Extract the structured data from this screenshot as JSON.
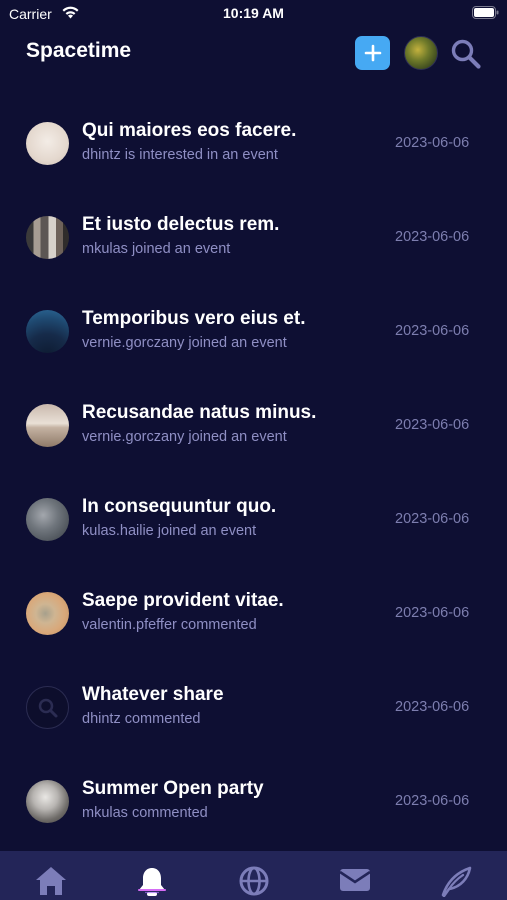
{
  "status_bar": {
    "carrier": "Carrier",
    "time": "10:19 AM"
  },
  "header": {
    "title": "Spacetime"
  },
  "activities": [
    {
      "title": "Qui maiores eos facere.",
      "subtitle": "dhintz is interested in an event",
      "date": "2023-06-06"
    },
    {
      "title": "Et iusto delectus rem.",
      "subtitle": "mkulas joined an event",
      "date": "2023-06-06"
    },
    {
      "title": "Temporibus vero eius et.",
      "subtitle": "vernie.gorczany joined an event",
      "date": "2023-06-06"
    },
    {
      "title": "Recusandae natus minus.",
      "subtitle": "vernie.gorczany joined an event",
      "date": "2023-06-06"
    },
    {
      "title": "In consequuntur quo.",
      "subtitle": "kulas.hailie joined an event",
      "date": "2023-06-06"
    },
    {
      "title": "Saepe provident vitae.",
      "subtitle": "valentin.pfeffer commented",
      "date": "2023-06-06"
    },
    {
      "title": "Whatever share",
      "subtitle": "dhintz commented",
      "date": "2023-06-06"
    },
    {
      "title": "Summer Open party",
      "subtitle": "mkulas commented",
      "date": "2023-06-06"
    }
  ],
  "tab_bar": {
    "tabs": [
      {
        "icon": "home-icon",
        "active": false
      },
      {
        "icon": "bell-icon",
        "active": true
      },
      {
        "icon": "globe-icon",
        "active": false
      },
      {
        "icon": "mail-icon",
        "active": false
      },
      {
        "icon": "feather-icon",
        "active": false
      }
    ]
  },
  "colors": {
    "background": "#0e0f33",
    "tab_bar": "#232558",
    "accent": "#46a9f3",
    "subtitle": "#8f8fc4",
    "date": "#7d7eaf",
    "icon_muted": "#7c7db9"
  }
}
